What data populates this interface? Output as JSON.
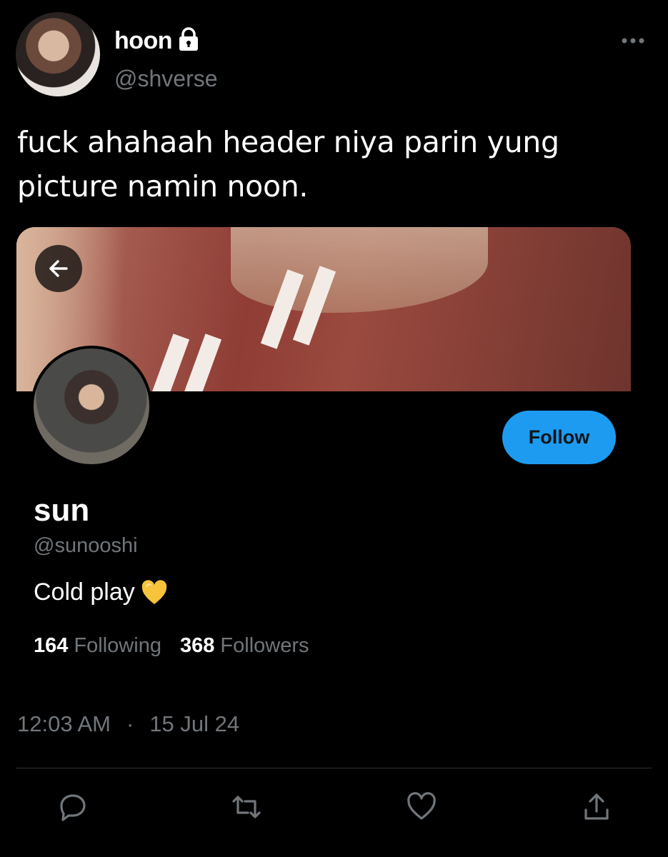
{
  "tweet": {
    "author_name": "hoon",
    "author_handle": "@shverse",
    "text": "fuck ahahaah header niya parin yung picture namin noon.",
    "time": "12:03 AM",
    "separator": "·",
    "date": "15 Jul 24"
  },
  "embedded_profile": {
    "name": "sun",
    "handle": "@sunooshi",
    "bio": "Cold play",
    "follow_label": "Follow",
    "following_count": "164",
    "following_label": "Following",
    "followers_count": "368",
    "followers_label": "Followers"
  },
  "icons": {
    "lock": "lock-icon",
    "more": "more-options-icon",
    "back": "back-arrow-icon",
    "bio_emoji": "yellow-heart-icon",
    "reply": "reply-icon",
    "retweet": "retweet-icon",
    "like": "like-icon",
    "share": "share-icon"
  },
  "colors": {
    "background": "#000000",
    "accent": "#1d9bf0",
    "secondary_text": "#71767b",
    "divider": "#2f3336"
  }
}
